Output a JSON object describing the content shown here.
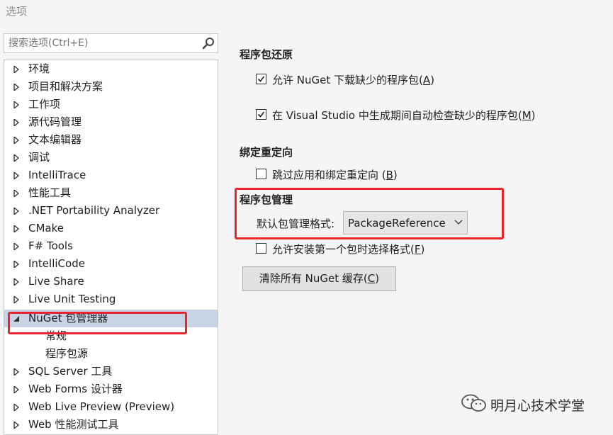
{
  "window": {
    "title": "选项"
  },
  "search": {
    "placeholder": "搜索选项(Ctrl+E)"
  },
  "tree": {
    "items": [
      {
        "label": "环境"
      },
      {
        "label": "项目和解决方案"
      },
      {
        "label": "工作项"
      },
      {
        "label": "源代码管理"
      },
      {
        "label": "文本编辑器"
      },
      {
        "label": "调试"
      },
      {
        "label": "IntelliTrace"
      },
      {
        "label": "性能工具"
      },
      {
        "label": ".NET Portability Analyzer"
      },
      {
        "label": "CMake"
      },
      {
        "label": "F# Tools"
      },
      {
        "label": "IntelliCode"
      },
      {
        "label": "Live Share"
      },
      {
        "label": "Live Unit Testing"
      },
      {
        "label": "NuGet 包管理器",
        "expanded": true,
        "selected": true
      },
      {
        "label": "常规",
        "child": true
      },
      {
        "label": "程序包源",
        "child": true
      },
      {
        "label": "SQL Server 工具"
      },
      {
        "label": "Web Forms 设计器"
      },
      {
        "label": "Web Live Preview (Preview)"
      },
      {
        "label": "Web 性能测试工具"
      }
    ]
  },
  "package_restore": {
    "title": "程序包还原",
    "allow_download": {
      "label_before": "允许 NuGet 下载缺少的程序包(",
      "accel": "A",
      "label_after": ")",
      "checked": true
    },
    "auto_check": {
      "label_before": "在 Visual Studio 中生成期间自动检查缺少的程序包(",
      "accel": "M",
      "label_after": ")",
      "checked": true
    }
  },
  "binding_redirects": {
    "title": "绑定重定向",
    "skip": {
      "label_before": "跳过应用和绑定重定向 (",
      "accel": "B",
      "label_after": ")",
      "checked": false
    }
  },
  "package_management": {
    "title": "程序包管理",
    "format_label": "默认包管理格式:",
    "format_value": "PackageReference",
    "allow_choose": {
      "label_before": "允许安装第一个包时选择格式(",
      "accel": "F",
      "label_after": ")",
      "checked": false
    }
  },
  "clear_cache": {
    "label_before": "清除所有 NuGet 缓存(",
    "accel": "C",
    "label_after": ")"
  },
  "watermark": {
    "text": "明月心技术学堂"
  },
  "colors": {
    "highlight": "#e8252b",
    "selection": "#c9d3e6"
  }
}
